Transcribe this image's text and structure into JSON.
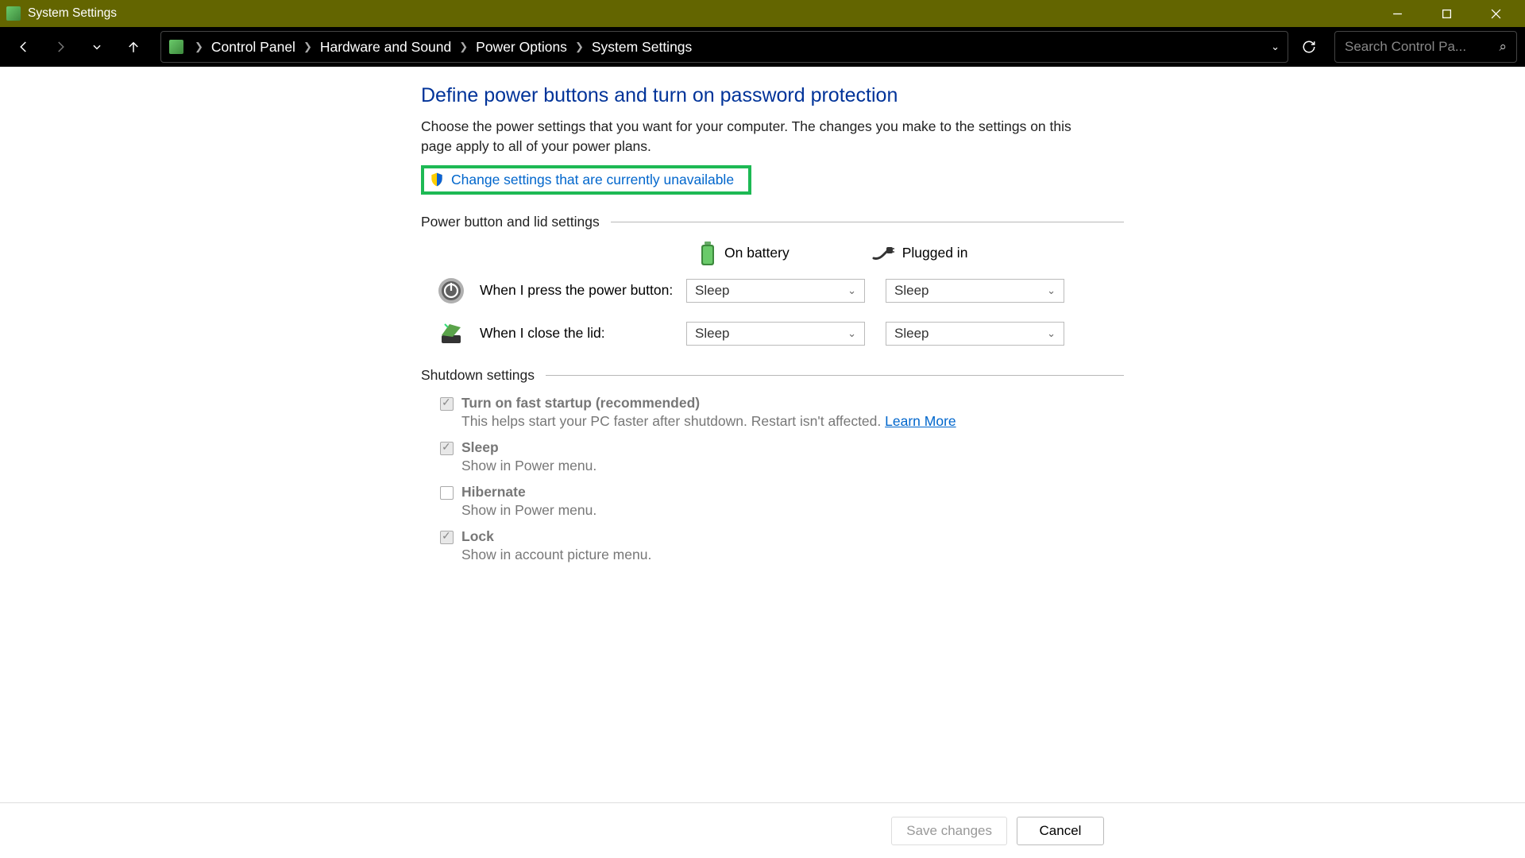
{
  "titlebar": {
    "title": "System Settings"
  },
  "breadcrumbs": [
    "Control Panel",
    "Hardware and Sound",
    "Power Options",
    "System Settings"
  ],
  "search": {
    "placeholder": "Search Control Pa..."
  },
  "page": {
    "title": "Define power buttons and turn on password protection",
    "description": "Choose the power settings that you want for your computer. The changes you make to the settings on this page apply to all of your power plans.",
    "admin_link": "Change settings that are currently unavailable"
  },
  "sections": {
    "power": "Power button and lid settings",
    "shutdown": "Shutdown settings"
  },
  "columns": {
    "battery": "On battery",
    "plugged": "Plugged in"
  },
  "rows": {
    "power_button": {
      "label": "When I press the power button:",
      "battery": "Sleep",
      "plugged": "Sleep"
    },
    "lid": {
      "label": "When I close the lid:",
      "battery": "Sleep",
      "plugged": "Sleep"
    }
  },
  "shutdown": [
    {
      "title": "Turn on fast startup (recommended)",
      "desc": "This helps start your PC faster after shutdown. Restart isn't affected.",
      "learn": "Learn More",
      "checked": true
    },
    {
      "title": "Sleep",
      "desc": "Show in Power menu.",
      "checked": true
    },
    {
      "title": "Hibernate",
      "desc": "Show in Power menu.",
      "checked": false
    },
    {
      "title": "Lock",
      "desc": "Show in account picture menu.",
      "checked": true
    }
  ],
  "footer": {
    "save": "Save changes",
    "cancel": "Cancel"
  }
}
